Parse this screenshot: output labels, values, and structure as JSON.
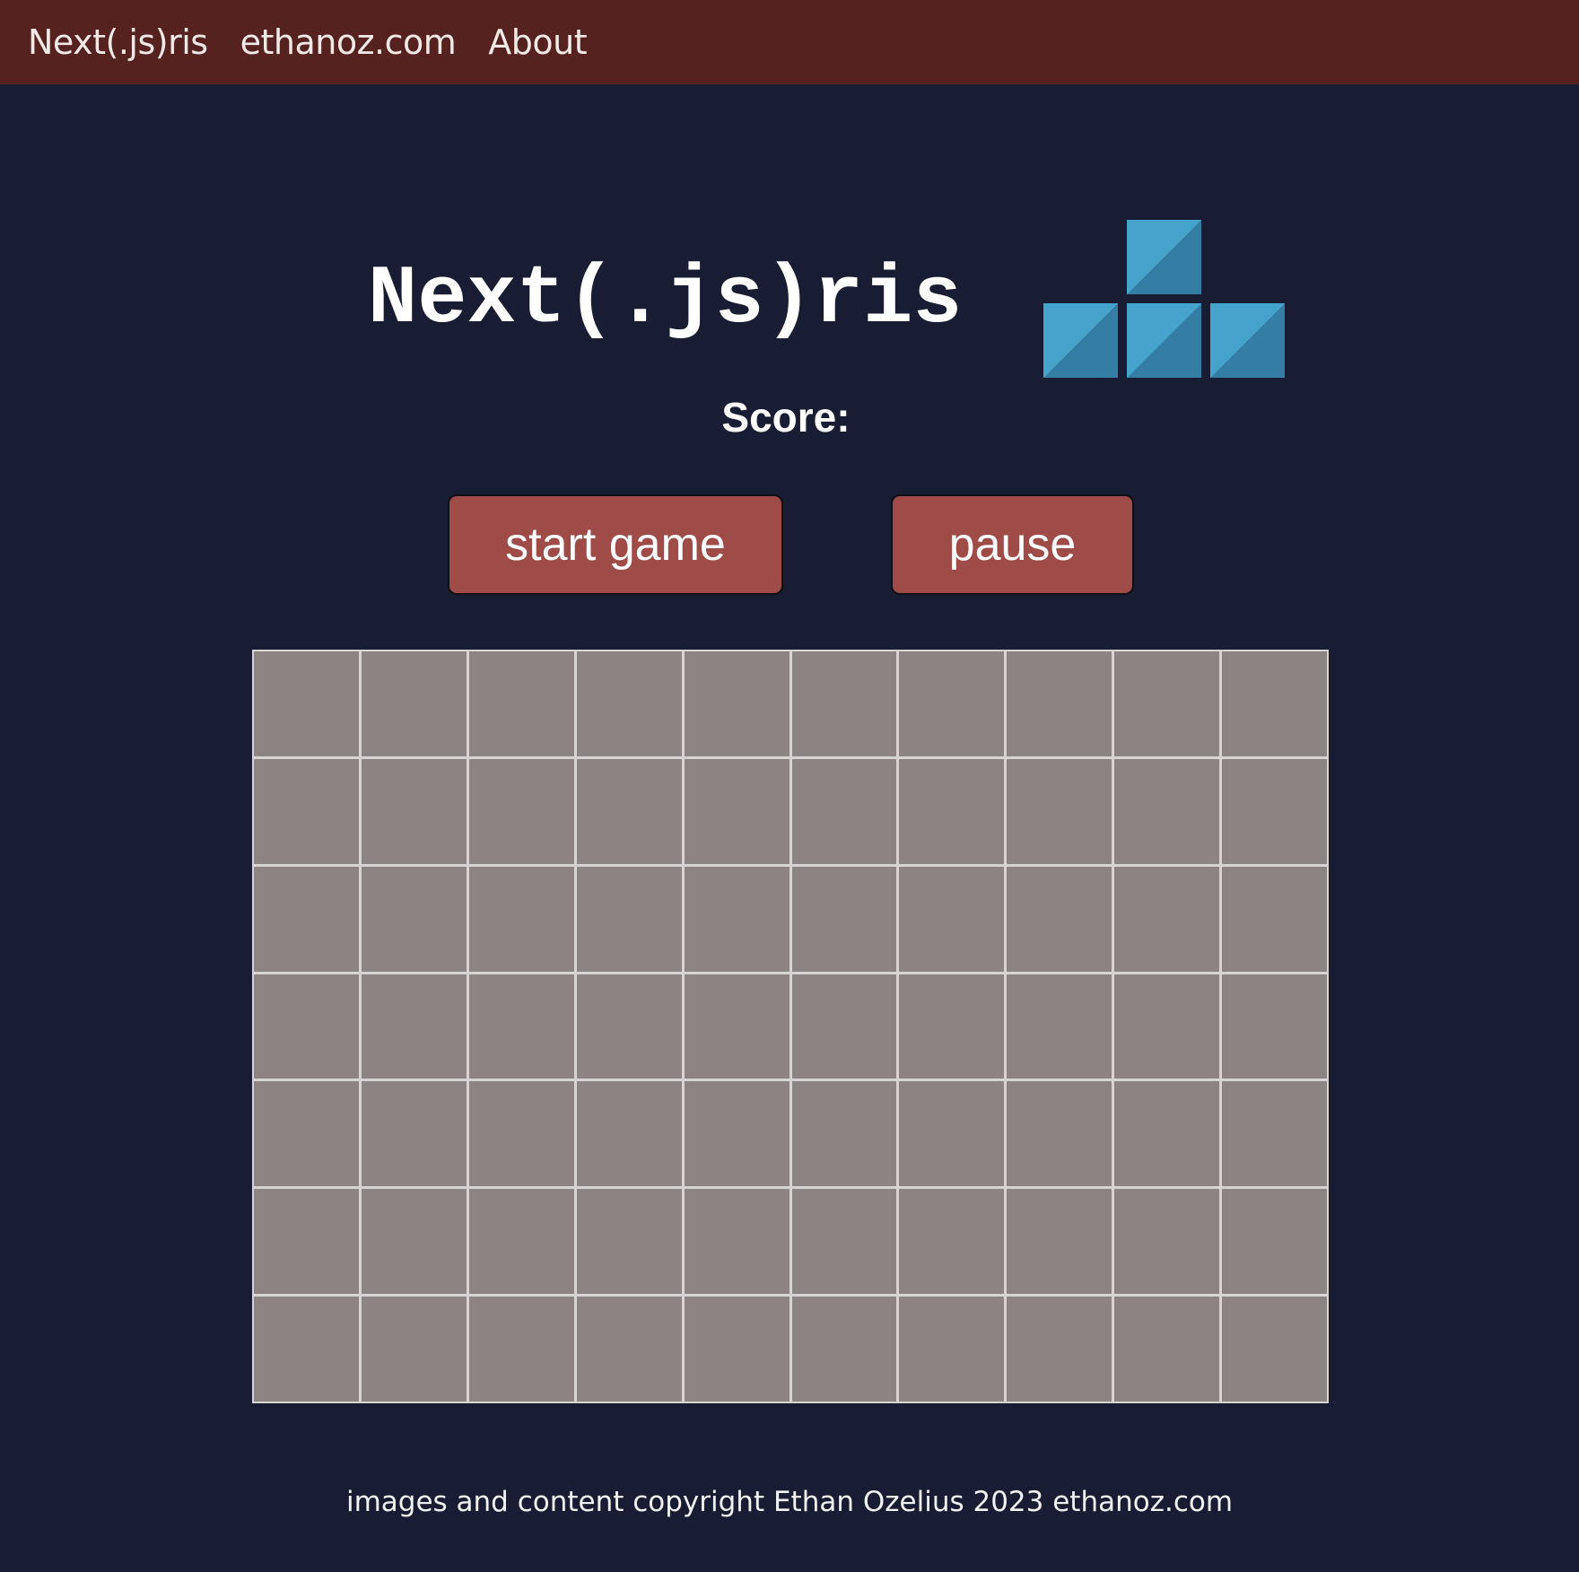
{
  "nav": {
    "items": [
      {
        "label": "Next(.js)ris"
      },
      {
        "label": "ethanoz.com"
      },
      {
        "label": "About"
      }
    ]
  },
  "game": {
    "title": "Next(.js)ris",
    "logo_icon": "tetromino-t-icon",
    "score_label": "Score:",
    "score_value": "",
    "start_label": "start game",
    "pause_label": "pause",
    "board": {
      "rows": 7,
      "cols": 10
    }
  },
  "footer": {
    "text": "images and content copyright Ethan Ozelius 2023 ethanoz.com"
  },
  "colors": {
    "background": "#181d33",
    "navbar": "#552220",
    "button": "#9f4b48",
    "cell": "#8b8482",
    "grid_line": "#d8d4d4",
    "block": "#3f9cc7"
  }
}
